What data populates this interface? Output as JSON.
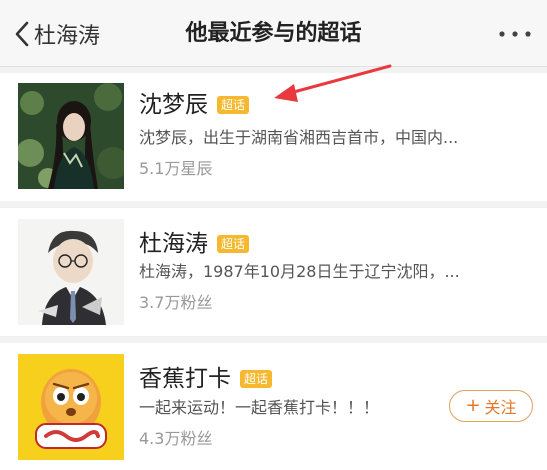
{
  "nav": {
    "back_label": "杜海涛",
    "title": "他最近参与的超话"
  },
  "items": [
    {
      "name": "沈梦辰",
      "badge": "超话",
      "description": "沈梦辰，出生于湖南省湘西吉首市，中国内...",
      "count": "5.1万星辰"
    },
    {
      "name": "杜海涛",
      "badge": "超话",
      "description": "杜海涛，1987年10月28日生于辽宁沈阳，...",
      "count": "3.7万粉丝"
    },
    {
      "name": "香蕉打卡",
      "badge": "超话",
      "description": "一起来运动！一起香蕉打卡！！！",
      "count": "4.3万粉丝",
      "follow_label": "关注"
    }
  ],
  "colors": {
    "badge": "#f5b82e",
    "follow": "#e07a2a",
    "arrow": "#e8393e"
  },
  "icons": [
    "back-chevron-icon",
    "more-dots-icon",
    "plus-icon",
    "red-arrow-annotation"
  ]
}
